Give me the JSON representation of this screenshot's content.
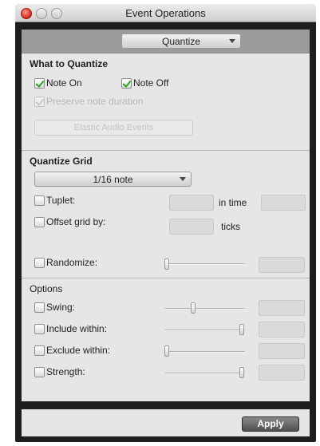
{
  "window": {
    "title": "Event Operations"
  },
  "mode_popup": {
    "selected": "Quantize"
  },
  "what_to_quantize": {
    "heading": "What to Quantize",
    "note_on": {
      "label": "Note On",
      "checked": true
    },
    "note_off": {
      "label": "Note Off",
      "checked": true
    },
    "preserve_duration": {
      "label": "Preserve note duration",
      "checked": true,
      "enabled": false
    },
    "elastic_button": {
      "label": "Elastic Audio Events",
      "enabled": false
    }
  },
  "quantize_grid": {
    "heading": "Quantize Grid",
    "grid_value": "1/16 note",
    "tuplet": {
      "label": "Tuplet:",
      "in_time_label": "in time"
    },
    "offset": {
      "label": "Offset grid by:",
      "unit_label": "ticks"
    },
    "randomize": {
      "label": "Randomize:",
      "slider_level": 0.0
    }
  },
  "options": {
    "heading": "Options",
    "swing": {
      "label": "Swing:",
      "slider_level": 0.35
    },
    "include_within": {
      "label": "Include within:",
      "slider_level": 1.0
    },
    "exclude_within": {
      "label": "Exclude within:",
      "slider_level": 0.0
    },
    "strength": {
      "label": "Strength:",
      "slider_level": 1.0
    }
  },
  "footer": {
    "apply_label": "Apply"
  },
  "colors": {
    "close_button": "#d2261a",
    "check_mark": "#2aa41e"
  }
}
